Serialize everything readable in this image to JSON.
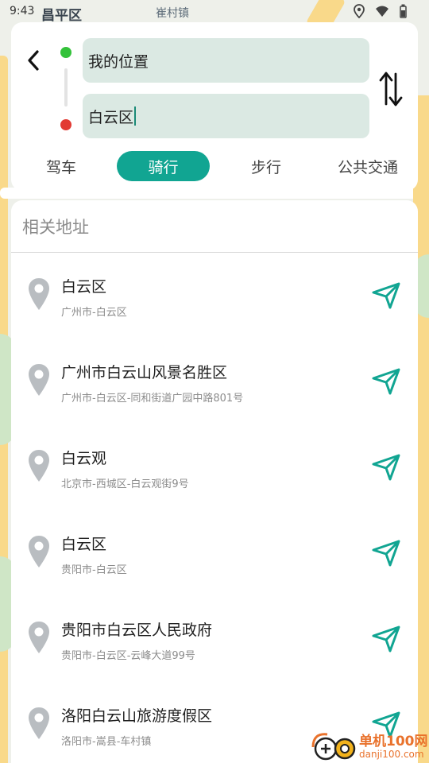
{
  "status_bar": {
    "time": "9:43",
    "icons": [
      "location-icon",
      "wifi-icon",
      "battery-icon"
    ]
  },
  "map": {
    "labels": [
      "昌平区",
      "崔村镇"
    ]
  },
  "route": {
    "from_value": "我的位置",
    "to_value": "白云区",
    "colors": {
      "start_dot": "#33c23a",
      "end_dot": "#e23a33",
      "field_bg": "#dbe9e3",
      "accent": "#11a592"
    }
  },
  "modes": [
    {
      "label": "驾车",
      "active": false
    },
    {
      "label": "骑行",
      "active": true
    },
    {
      "label": "步行",
      "active": false
    },
    {
      "label": "公共交通",
      "active": false
    }
  ],
  "results": {
    "header": "相关地址",
    "items": [
      {
        "title": "白云区",
        "subtitle": "广州市-白云区"
      },
      {
        "title": "广州市白云山风景名胜区",
        "subtitle": "广州市-白云区-同和街道广园中路801号"
      },
      {
        "title": "白云观",
        "subtitle": "北京市-西城区-白云观街9号"
      },
      {
        "title": "白云区",
        "subtitle": "贵阳市-白云区"
      },
      {
        "title": "贵阳市白云区人民政府",
        "subtitle": "贵阳市-白云区-云峰大道99号"
      },
      {
        "title": "洛阳白云山旅游度假区",
        "subtitle": "洛阳市-嵩县-车村镇"
      }
    ]
  },
  "watermark": {
    "name": "单机100网",
    "url": "danji100.com"
  }
}
